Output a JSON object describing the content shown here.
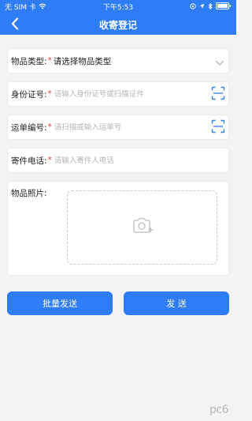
{
  "status_bar": {
    "carrier": "无 SIM 卡",
    "time": "下午5:53"
  },
  "header": {
    "title": "收寄登记"
  },
  "form": {
    "item_type": {
      "label": "物品类型:",
      "required": "*",
      "value": "请选择物品类型"
    },
    "id_number": {
      "label": "身份证号:",
      "required": "*",
      "placeholder": "请输入身份证号或扫描证件"
    },
    "waybill_number": {
      "label": "运单编号:",
      "required": "*",
      "placeholder": "请扫描或输入运单号"
    },
    "sender_phone": {
      "label": "寄件电话:",
      "required": "*",
      "placeholder": "请输入寄件人电话"
    },
    "item_photo": {
      "label": "物品照片:"
    }
  },
  "buttons": {
    "batch_send": "批量发送",
    "send": "发 送"
  },
  "watermark": {
    "text": "pc6"
  }
}
